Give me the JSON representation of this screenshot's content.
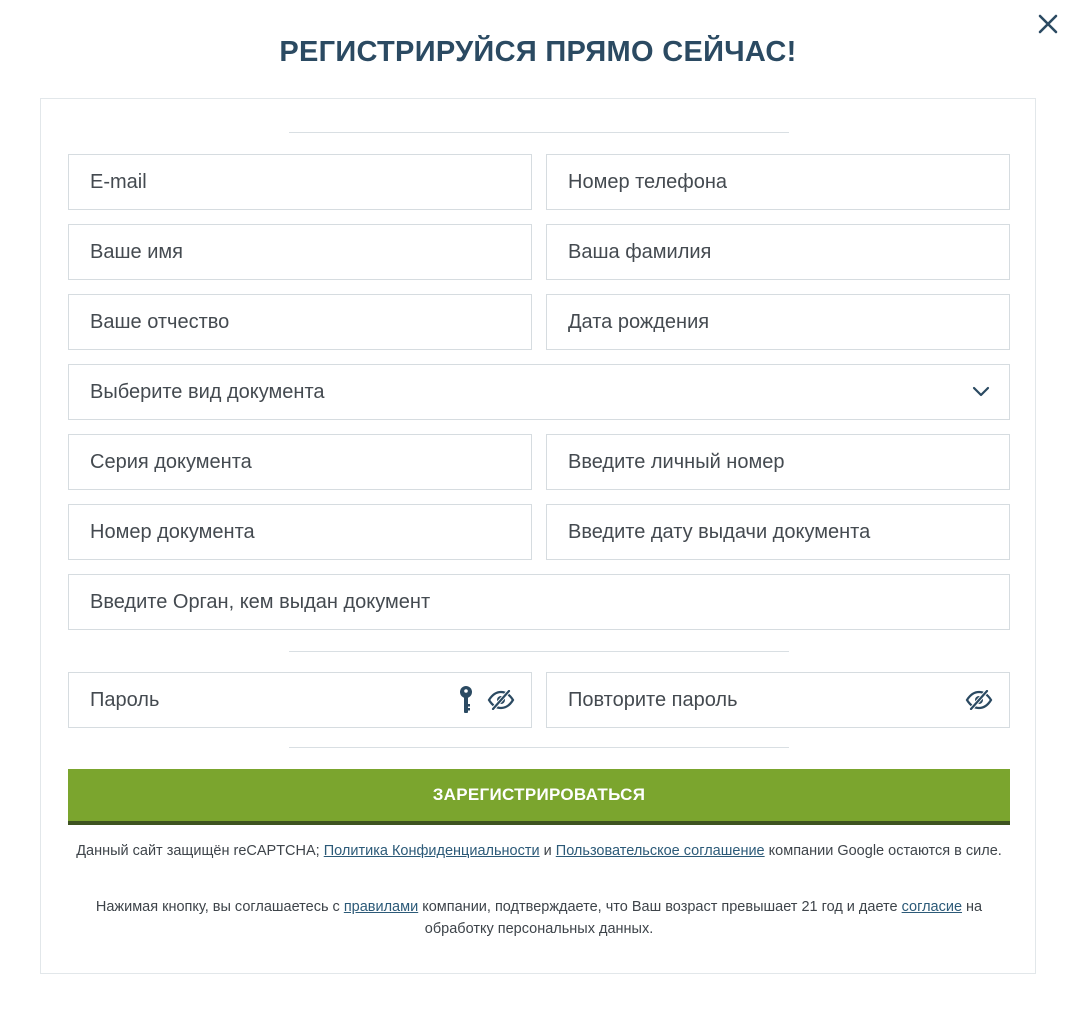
{
  "title": "РЕГИСТРИРУЙСЯ ПРЯМО СЕЙЧАС!",
  "colors": {
    "title": "#2b4a62",
    "accent_green": "#7ba52e",
    "link": "#2c5a78"
  },
  "icons": {
    "close": "close-icon",
    "dropdown": "chevron-down-icon",
    "password_generator": "key-icon",
    "visibility": "eye-slash-icon"
  },
  "fields": {
    "email": {
      "placeholder": "E-mail"
    },
    "phone": {
      "placeholder": "Номер телефона"
    },
    "first_name": {
      "placeholder": "Ваше имя"
    },
    "last_name": {
      "placeholder": "Ваша фамилия"
    },
    "patronymic": {
      "placeholder": "Ваше отчество"
    },
    "birth_date": {
      "placeholder": "Дата рождения"
    },
    "document_type": {
      "placeholder": "Выберите вид документа"
    },
    "document_series": {
      "placeholder": "Серия документа"
    },
    "personal_number": {
      "placeholder": "Введите личный номер"
    },
    "document_number": {
      "placeholder": "Номер документа"
    },
    "issue_date": {
      "placeholder": "Введите дату выдачи документа"
    },
    "issuing_authority": {
      "placeholder": "Введите Орган, кем выдан документ"
    },
    "password": {
      "placeholder": "Пароль"
    },
    "password_repeat": {
      "placeholder": "Повторите пароль"
    }
  },
  "submit_label": "ЗАРЕГИСТРИРОВАТЬСЯ",
  "recaptcha_note": {
    "prefix": "Данный сайт защищён reCAPTCHA; ",
    "privacy_link": "Политика Конфиденциальности",
    "and": " и ",
    "terms_link": "Пользовательское соглашение",
    "suffix": " компании Google остаются в силе."
  },
  "consent_note": {
    "prefix": "Нажимая кнопку, вы соглашаетесь с ",
    "rules_link": "правилами",
    "middle": " компании, подтверждаете, что Ваш возраст превышает 21 год и даете ",
    "consent_link": "согласие",
    "suffix": " на обработку персональных данных."
  }
}
